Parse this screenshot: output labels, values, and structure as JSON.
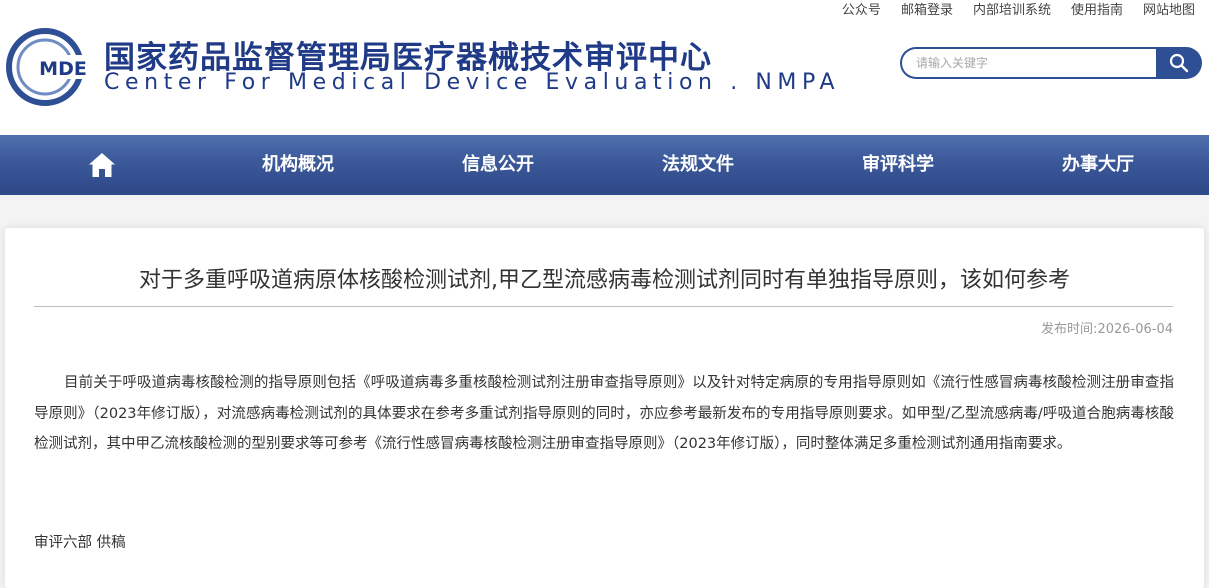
{
  "top_links": [
    "公众号",
    "邮箱登录",
    "内部培训系统",
    "使用指南",
    "网站地图"
  ],
  "logo": {
    "text": "MDE"
  },
  "site": {
    "title_cn": "国家药品监督管理局医疗器械技术审评中心",
    "title_en": "Center For Medical Device Evaluation . NMPA"
  },
  "search": {
    "placeholder": "请输入关键字"
  },
  "nav": {
    "home_icon": "home-icon",
    "items": [
      "机构概况",
      "信息公开",
      "法规文件",
      "审评科学",
      "办事大厅"
    ]
  },
  "article": {
    "title": "对于多重呼吸道病原体核酸检测试剂,甲乙型流感病毒检测试剂同时有单独指导原则，该如何参考",
    "pubdate_label": "发布时间:",
    "pubdate": "2026-06-04",
    "body": "目前关于呼吸道病毒核酸检测的指导原则包括《呼吸道病毒多重核酸检测试剂注册审查指导原则》以及针对特定病原的专用指导原则如《流行性感冒病毒核酸检测注册审查指导原则》（2023年修订版），对流感病毒检测试剂的具体要求在参考多重试剂指导原则的同时，亦应参考最新发布的专用指导原则要求。如甲型/乙型流感病毒/呼吸道合胞病毒核酸检测试剂，其中甲乙流核酸检测的型别要求等可参考《流行性感冒病毒核酸检测注册审查指导原则》（2023年修订版），同时整体满足多重检测试剂通用指南要求。",
    "signature": "审评六部 供稿"
  },
  "colors": {
    "brand_blue": "#2f4f95",
    "nav_top": "#4f6fad",
    "nav_bottom": "#2e4888",
    "title_blue": "#1f3a86"
  }
}
